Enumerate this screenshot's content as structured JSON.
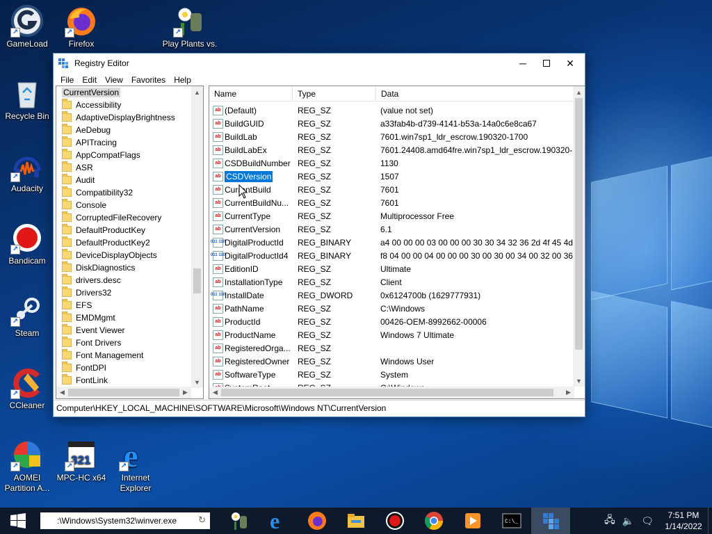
{
  "desktop": {
    "icons": [
      {
        "label": "GameLoad",
        "icon": "gameload-icon"
      },
      {
        "label": "Firefox",
        "icon": "firefox-icon"
      },
      {
        "label": "Play Plants vs.",
        "icon": "plants-vs-zombies-icon"
      },
      {
        "label": "Recycle Bin",
        "icon": "recycle-bin-icon"
      },
      {
        "label": "Audacity",
        "icon": "audacity-icon"
      },
      {
        "label": "Bandicam",
        "icon": "bandicam-icon"
      },
      {
        "label": "Steam",
        "icon": "steam-icon"
      },
      {
        "label": "CCleaner",
        "icon": "ccleaner-icon"
      },
      {
        "label": "AOMEI Partition A...",
        "icon": "aomei-icon"
      },
      {
        "label": "MPC-HC x64",
        "icon": "mpc-hc-icon"
      },
      {
        "label": "Internet Explorer",
        "icon": "internet-explorer-icon"
      }
    ]
  },
  "window": {
    "title": "Registry Editor",
    "menu": [
      "File",
      "Edit",
      "View",
      "Favorites",
      "Help"
    ],
    "tree": {
      "root": "CurrentVersion",
      "items": [
        "Accessibility",
        "AdaptiveDisplayBrightness",
        "AeDebug",
        "APITracing",
        "AppCompatFlags",
        "ASR",
        "Audit",
        "Compatibility32",
        "Console",
        "CorruptedFileRecovery",
        "DefaultProductKey",
        "DefaultProductKey2",
        "DeviceDisplayObjects",
        "DiskDiagnostics",
        "drivers.desc",
        "Drivers32",
        "EFS",
        "EMDMgmt",
        "Event Viewer",
        "Font Drivers",
        "Font Management",
        "FontDPI",
        "FontLink"
      ]
    },
    "list": {
      "headers": {
        "name": "Name",
        "type": "Type",
        "data": "Data"
      },
      "rows": [
        {
          "name": "(Default)",
          "type": "REG_SZ",
          "data": "(value not set)",
          "icon": "sz"
        },
        {
          "name": "BuildGUID",
          "type": "REG_SZ",
          "data": "a33fab4b-d739-4141-b53a-14a0c6e8ca67",
          "icon": "sz"
        },
        {
          "name": "BuildLab",
          "type": "REG_SZ",
          "data": "7601.win7sp1_ldr_escrow.190320-1700",
          "icon": "sz"
        },
        {
          "name": "BuildLabEx",
          "type": "REG_SZ",
          "data": "7601.24408.amd64fre.win7sp1_ldr_escrow.190320-1...",
          "icon": "sz"
        },
        {
          "name": "CSDBuildNumber",
          "type": "REG_SZ",
          "data": "1130",
          "icon": "sz"
        },
        {
          "name": "CSDVersion",
          "type": "REG_SZ",
          "data": "1507",
          "icon": "sz",
          "selected": true
        },
        {
          "name": "CurrentBuild",
          "type": "REG_SZ",
          "data": "7601",
          "icon": "sz"
        },
        {
          "name": "CurrentBuildNu...",
          "type": "REG_SZ",
          "data": "7601",
          "icon": "sz"
        },
        {
          "name": "CurrentType",
          "type": "REG_SZ",
          "data": "Multiprocessor Free",
          "icon": "sz"
        },
        {
          "name": "CurrentVersion",
          "type": "REG_SZ",
          "data": "6.1",
          "icon": "sz"
        },
        {
          "name": "DigitalProductId",
          "type": "REG_BINARY",
          "data": "a4 00 00 00 03 00 00 00 30 30 34 32 36 2d 4f 45 4d 2...",
          "icon": "bin"
        },
        {
          "name": "DigitalProductId4",
          "type": "REG_BINARY",
          "data": "f8 04 00 00 04 00 00 00 30 00 30 00 34 00 32 00 36 00...",
          "icon": "bin"
        },
        {
          "name": "EditionID",
          "type": "REG_SZ",
          "data": "Ultimate",
          "icon": "sz"
        },
        {
          "name": "InstallationType",
          "type": "REG_SZ",
          "data": "Client",
          "icon": "sz"
        },
        {
          "name": "InstallDate",
          "type": "REG_DWORD",
          "data": "0x6124700b (1629777931)",
          "icon": "bin"
        },
        {
          "name": "PathName",
          "type": "REG_SZ",
          "data": "C:\\Windows",
          "icon": "sz"
        },
        {
          "name": "ProductId",
          "type": "REG_SZ",
          "data": "00426-OEM-8992662-00006",
          "icon": "sz"
        },
        {
          "name": "ProductName",
          "type": "REG_SZ",
          "data": "Windows 7 Ultimate",
          "icon": "sz"
        },
        {
          "name": "RegisteredOrga...",
          "type": "REG_SZ",
          "data": "",
          "icon": "sz"
        },
        {
          "name": "RegisteredOwner",
          "type": "REG_SZ",
          "data": "Windows User",
          "icon": "sz"
        },
        {
          "name": "SoftwareType",
          "type": "REG_SZ",
          "data": "System",
          "icon": "sz"
        },
        {
          "name": "SystemRoot",
          "type": "REG_SZ",
          "data": "C:\\Windows",
          "icon": "sz"
        }
      ]
    },
    "status": "Computer\\HKEY_LOCAL_MACHINE\\SOFTWARE\\Microsoft\\Windows NT\\CurrentVersion"
  },
  "taskbar": {
    "run_value": ":\\Windows\\System32\\winver.exe",
    "apps": [
      "plants-vs-zombies-icon",
      "edge-icon",
      "firefox-icon",
      "file-explorer-icon",
      "bandicam-icon",
      "chrome-icon",
      "media-player-icon",
      "command-prompt-icon",
      "registry-editor-icon"
    ],
    "time": "7:51 PM",
    "date": "1/14/2022"
  },
  "colors": {
    "selection": "#0078d7",
    "taskbar": "#0e1a2b"
  }
}
